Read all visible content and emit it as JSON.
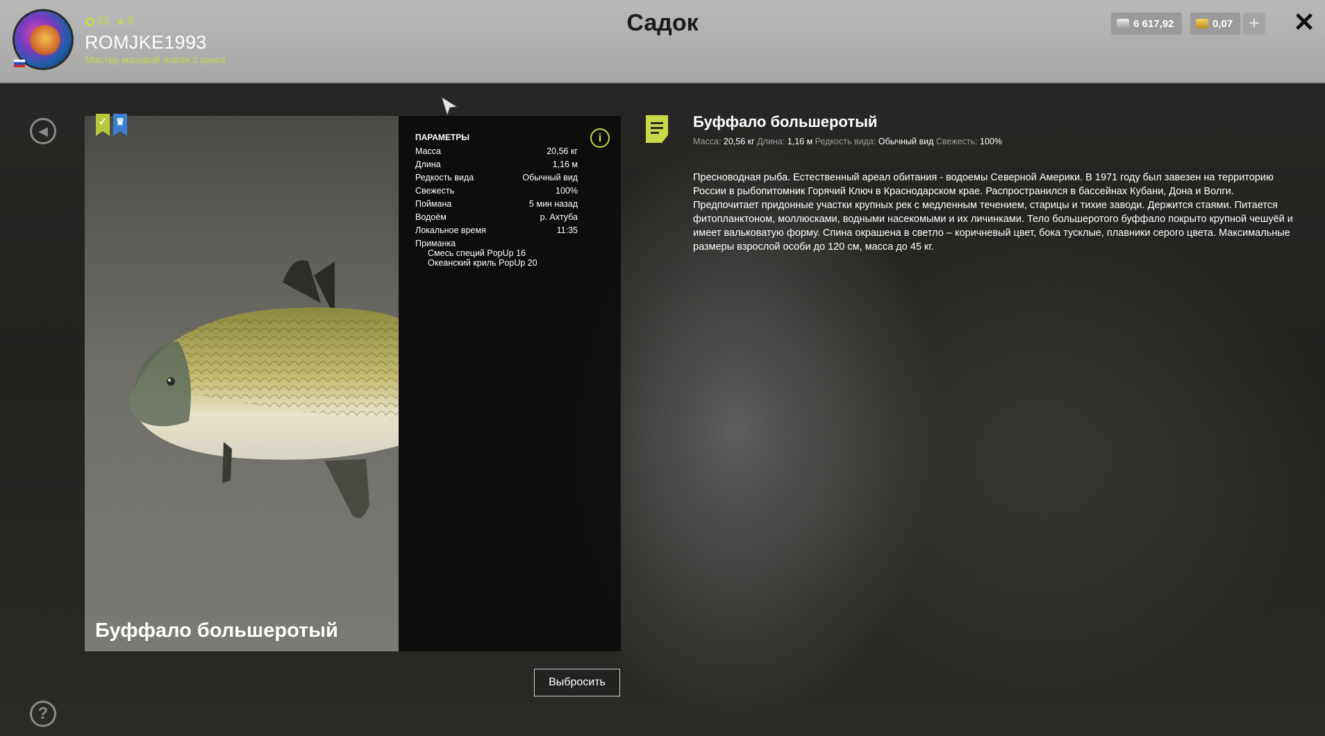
{
  "header": {
    "title": "Садок",
    "player": {
      "level": "33",
      "stars": "9",
      "username": "ROMJKE1993",
      "rank": "Мастер маховой ловли 2 ранга"
    },
    "currency": {
      "silver": "6 617,92",
      "gold": "0,07"
    },
    "add_label": "+",
    "close_label": "✕"
  },
  "card": {
    "fish_name": "Буффало большеротый",
    "params_title": "ПАРАМЕТРЫ",
    "params": [
      {
        "label": "Масса",
        "value": "20,56 кг"
      },
      {
        "label": "Длина",
        "value": "1,16 м"
      },
      {
        "label": "Редкость вида",
        "value": "Обычный вид"
      },
      {
        "label": "Свежесть",
        "value": "100%"
      },
      {
        "label": "Поймана",
        "value": "5 мин назад"
      },
      {
        "label": "Водоём",
        "value": "р. Ахтуба"
      },
      {
        "label": "Локальное время",
        "value": "11:35"
      }
    ],
    "bait_label": "Приманка",
    "baits": [
      "Смесь специй PopUp 16",
      "Океанский криль PopUp 20"
    ],
    "discard_label": "Выбросить"
  },
  "description": {
    "title": "Буффало большеротый",
    "meta": [
      {
        "key": "Масса:",
        "value": "20,56 кг"
      },
      {
        "key": "Длина:",
        "value": "1,16 м"
      },
      {
        "key": "Редкость вида:",
        "value": "Обычный вид"
      },
      {
        "key": "Свежесть:",
        "value": "100%"
      }
    ],
    "text": "Пресноводная рыба. Естественный ареал обитания - водоемы Северной Америки. В 1971 году был завезен на территорию России в рыбопитомник Горячий Ключ в Краснодарском крае. Распространился в бассейнах Кубани, Дона и Волги. Предпочитает придонные участки крупных рек с медленным течением, старицы и тихие заводи. Держится стаями. Питается фитопланктоном, моллюсками, водными насекомыми и их личинками. Тело большеротого буффало покрыто крупной чешуёй и имеет вальковатую форму. Спина окрашена в светло – коричневый цвет, бока тусклые, плавники серого цвета. Максимальные размеры взрослой особи до 120 см, масса до 45 кг."
  },
  "icons": {
    "back": "back-arrow-icon",
    "help": "question-icon",
    "info": "info-icon",
    "document": "document-icon",
    "badge_check": "check-bookmark-icon",
    "badge_crown": "crown-bookmark-icon"
  },
  "colors": {
    "accent": "#c7d84a",
    "badge_blue": "#3c7fd2"
  }
}
